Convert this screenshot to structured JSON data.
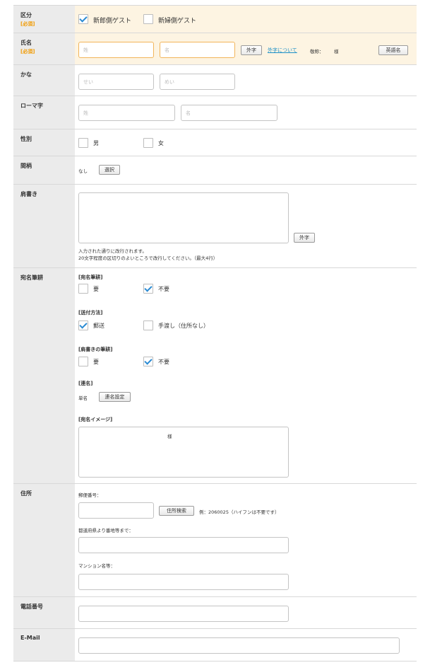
{
  "kubun": {
    "label": "区分",
    "required": "[必須]",
    "opt1": "新郎側ゲスト",
    "opt2": "新婦側ゲスト"
  },
  "name": {
    "label": "氏名",
    "required": "[必須]",
    "sei_ph": "姓",
    "mei_ph": "名",
    "gaiji_btn": "外字",
    "gaiji_link": "外字について",
    "keisho_label": "敬称：",
    "keisho_val": "様",
    "eigo_btn": "英語名"
  },
  "kana": {
    "label": "かな",
    "sei_ph": "せい",
    "mei_ph": "めい"
  },
  "roma": {
    "label": "ローマ字",
    "sei_ph": "姓",
    "mei_ph": "名"
  },
  "gender": {
    "label": "性別",
    "male": "男",
    "female": "女"
  },
  "relation": {
    "label": "間柄",
    "value": "なし",
    "select_btn": "選択"
  },
  "katagaki": {
    "label": "肩書き",
    "gaiji_btn": "外字",
    "note1": "入力された通りに改行されます。",
    "note2": "20文字程度の区切りのよいところで改行してください。（最大4行）"
  },
  "atena": {
    "label": "宛名筆耕",
    "sec1": "[宛名筆耕]",
    "sec1_opt1": "要",
    "sec1_opt2": "不要",
    "sec2": "[送付方法]",
    "sec2_opt1": "郵送",
    "sec2_opt2": "手渡し（住所なし）",
    "sec3": "[肩書きの筆耕]",
    "sec3_opt1": "要",
    "sec3_opt2": "不要",
    "sec4": "[連名]",
    "renmei_val": "単名",
    "renmei_btn": "連名設定",
    "sec5": "[宛名イメージ]",
    "image_text": "様"
  },
  "address": {
    "label": "住所",
    "zip_label": "郵便番号：",
    "search_btn": "住所検索",
    "zip_example": "例：2060025（ハイフンは不要です）",
    "pref_label": "都道府県より番地等まで：",
    "mansion_label": "マンション名等："
  },
  "phone": {
    "label": "電話番号"
  },
  "email": {
    "label": "E-Mail"
  }
}
